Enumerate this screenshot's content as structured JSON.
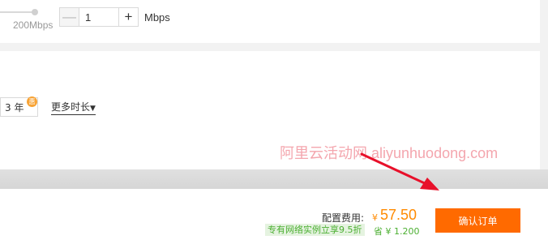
{
  "bandwidth": {
    "slider_max_label": "200Mbps",
    "stepper_minus": "—",
    "stepper_value": "1",
    "stepper_plus": "+",
    "unit": "Mbps"
  },
  "duration": {
    "year_option": "3 年",
    "discount_badge": "惠",
    "more_label": "更多时长",
    "more_caret": "▼"
  },
  "watermark": "阿里云活动网 aliyunhuodong.com",
  "footer": {
    "fee_label": "配置费用:",
    "currency": "¥",
    "fee_amount": "57.50",
    "promo_tag": "专有网络实例立享9.5折",
    "savings": "省 ¥ 1.200",
    "confirm_button": "确认订单"
  },
  "colors": {
    "accent": "#ff6a00",
    "price": "#ff8a00",
    "promo_green": "#4caf32",
    "annotation_arrow": "#e8102a"
  }
}
